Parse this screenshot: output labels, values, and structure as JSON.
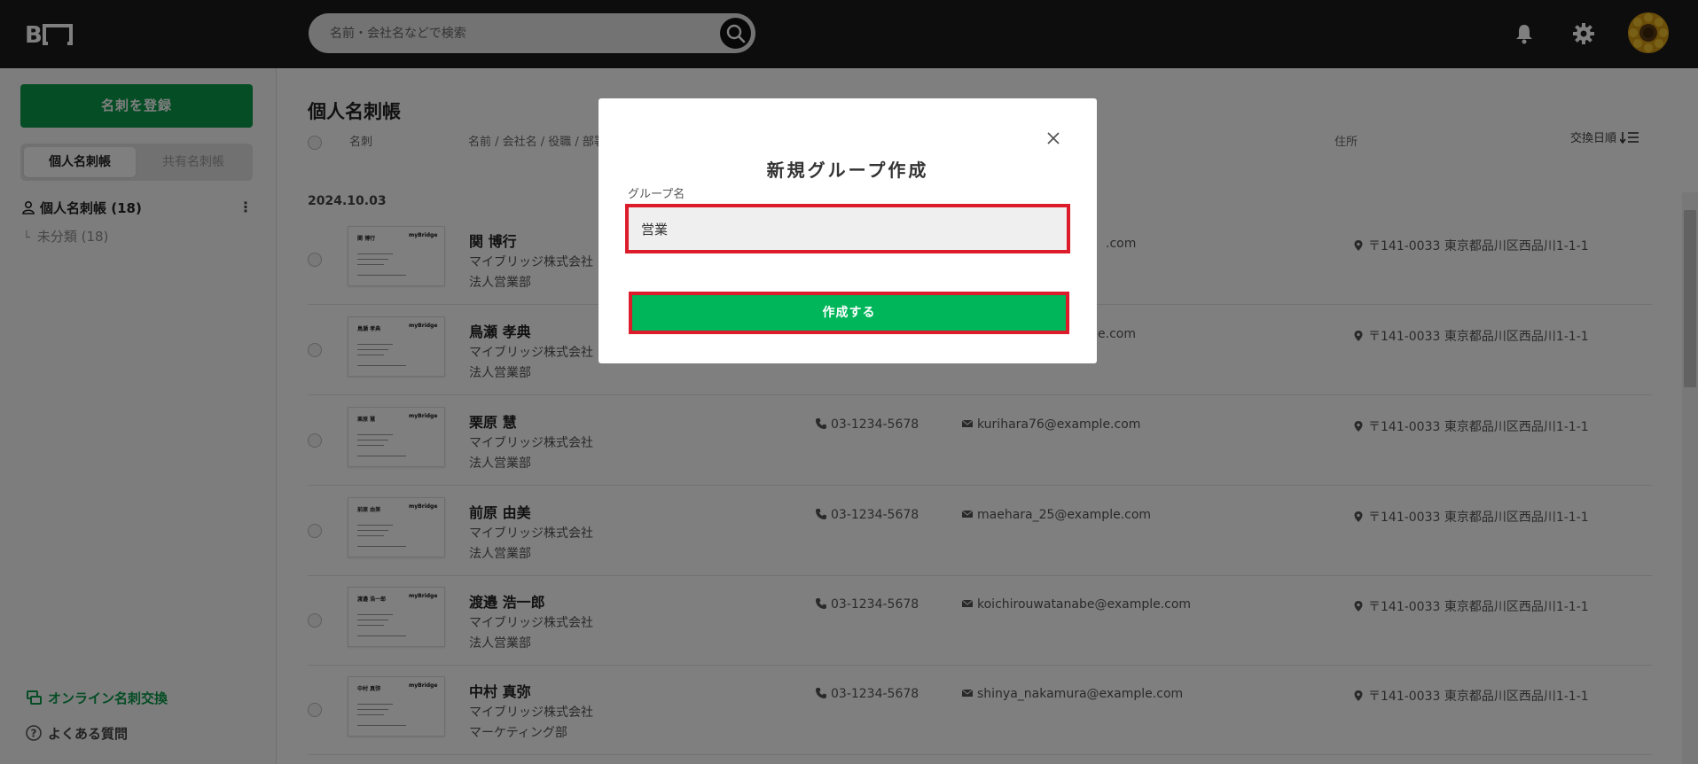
{
  "search": {
    "placeholder": "名前・会社名などで検索"
  },
  "colors": {
    "brand_green": "#0a9a4a",
    "highlight_red": "#dc1c2a",
    "topbar": "#1a1a1a"
  },
  "sidebar": {
    "register_label": "名刺を登録",
    "tabs": [
      {
        "label": "個人名刺帳",
        "active": true
      },
      {
        "label": "共有名刺帳",
        "active": false
      }
    ],
    "group_label": "個人名刺帳 (18)",
    "more_glyph": "⋮",
    "subgroup_label": "未分類 (18)",
    "online_exchange_label": "オンライン名刺交換",
    "faq_label": "よくある質問"
  },
  "main": {
    "title": "個人名刺帳",
    "columns": {
      "card": "名刺",
      "name": "名前 / 会社名 / 役職 / 部署",
      "address": "住所"
    },
    "sort_label": "交換日順",
    "date_group": "2024.10.03",
    "rows": [
      {
        "name": "関 博行",
        "company": "マイブリッジ株式会社",
        "dept": "法人営業部",
        "tel": "",
        "email": "",
        "email_partial": ".com",
        "address": "〒141-0033 東京都品川区西品川1-1-1"
      },
      {
        "name": "鳥瀬 孝典",
        "company": "マイブリッジ株式会社",
        "dept": "法人営業部",
        "tel": "",
        "email": "",
        "email_partial": "e.com",
        "address": "〒141-0033 東京都品川区西品川1-1-1"
      },
      {
        "name": "栗原 慧",
        "company": "マイブリッジ株式会社",
        "dept": "法人営業部",
        "tel": "03-1234-5678",
        "email": "kurihara76@example.com",
        "address": "〒141-0033 東京都品川区西品川1-1-1"
      },
      {
        "name": "前原 由美",
        "company": "マイブリッジ株式会社",
        "dept": "法人営業部",
        "tel": "03-1234-5678",
        "email": "maehara_25@example.com",
        "address": "〒141-0033 東京都品川区西品川1-1-1"
      },
      {
        "name": "渡邉 浩一郎",
        "company": "マイブリッジ株式会社",
        "dept": "法人営業部",
        "tel": "03-1234-5678",
        "email": "koichirouwatanabe@example.com",
        "address": "〒141-0033 東京都品川区西品川1-1-1"
      },
      {
        "name": "中村 真弥",
        "company": "マイブリッジ株式会社",
        "dept": "マーケティング部",
        "tel": "03-1234-5678",
        "email": "shinya_nakamura@example.com",
        "address": "〒141-0033 東京都品川区西品川1-1-1"
      }
    ],
    "card_brand": "myBridge"
  },
  "modal": {
    "title": "新規グループ作成",
    "field_label": "グループ名",
    "field_value": "営業",
    "submit_label": "作成する"
  }
}
